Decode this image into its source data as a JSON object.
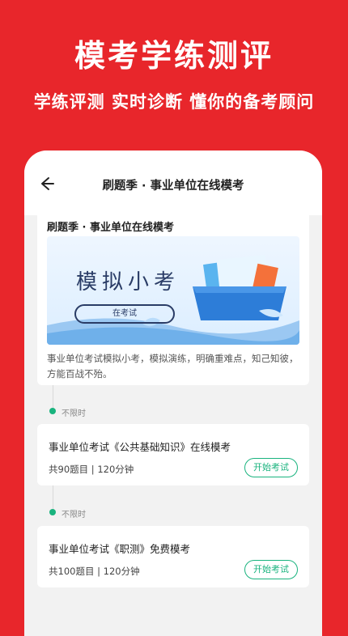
{
  "hero": {
    "title": "模考学练测评",
    "subtitle": "学练评测  实时诊断  懂你的备考顾问"
  },
  "navbar": {
    "title": "刷题季 · 事业单位在线模考"
  },
  "intro_card": {
    "title": "刷题季 · 事业单位在线模考",
    "banner_text": "模拟小考",
    "banner_pill": "在考试",
    "description": "事业单位考试模拟小考，模拟演练，明确重难点，知己知彼，方能百战不殆。"
  },
  "exams": [
    {
      "time_label": "不限时",
      "title": "事业单位考试《公共基础知识》在线模考",
      "meta": "共90题目 | 120分钟",
      "button": "开始考试"
    },
    {
      "time_label": "不限时",
      "title": "事业单位考试《职测》免费模考",
      "meta": "共100题目 | 120分钟",
      "button": "开始考试"
    }
  ],
  "colors": {
    "background": "#e8262b",
    "accent_green": "#19b37e"
  }
}
